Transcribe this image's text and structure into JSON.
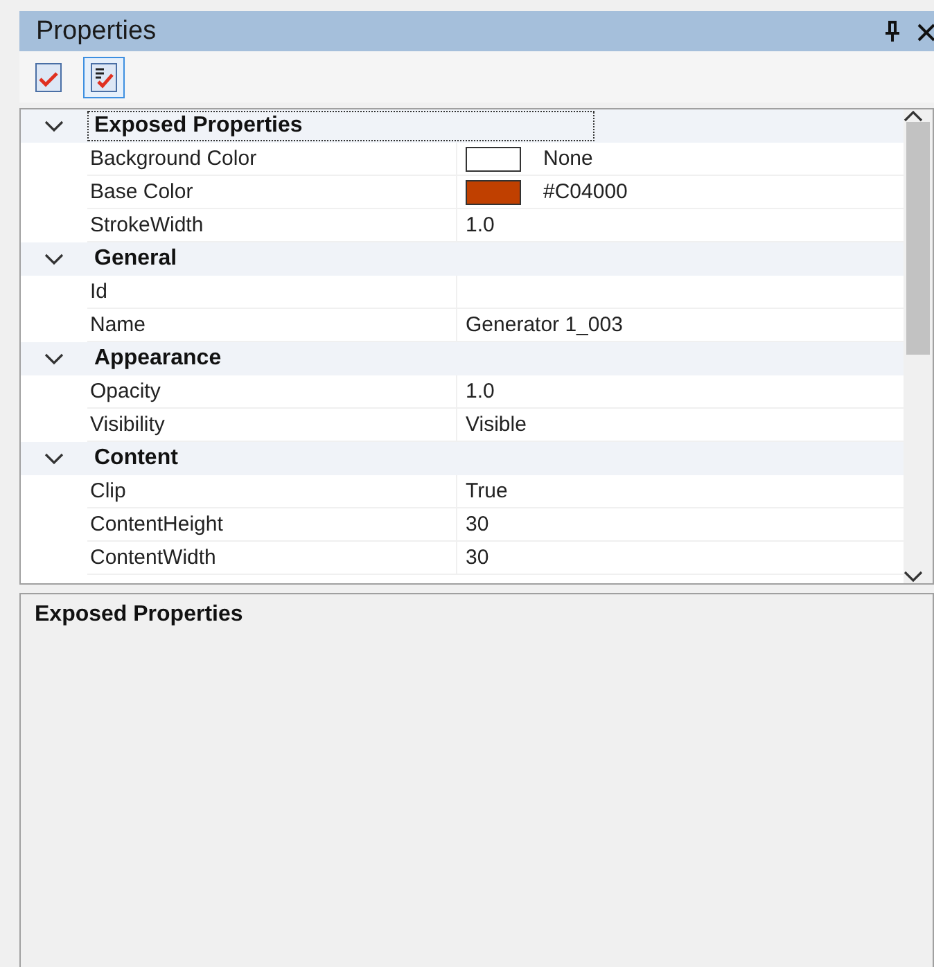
{
  "window": {
    "title": "Properties"
  },
  "toolbar": [
    {
      "kind": "categorized",
      "selected": false
    },
    {
      "kind": "alphabetical",
      "selected": true
    }
  ],
  "groups": [
    {
      "name": "Exposed Properties",
      "expanded": true,
      "focused": true,
      "properties": [
        {
          "name": "Background Color",
          "kind": "color",
          "color": "#ffffff",
          "value": "None"
        },
        {
          "name": "Base Color",
          "kind": "color",
          "color": "#c04000",
          "value": "#C04000"
        },
        {
          "name": "StrokeWidth",
          "kind": "text",
          "value": "1.0"
        }
      ]
    },
    {
      "name": "General",
      "expanded": true,
      "focused": false,
      "properties": [
        {
          "name": "Id",
          "kind": "text"
        },
        {
          "name": "Name",
          "kind": "text",
          "value": "Generator 1_003"
        }
      ]
    },
    {
      "name": "Appearance",
      "expanded": true,
      "focused": false,
      "properties": [
        {
          "name": "Opacity",
          "kind": "text",
          "value": "1.0"
        },
        {
          "name": "Visibility",
          "kind": "text",
          "value": "Visible"
        }
      ]
    },
    {
      "name": "Content",
      "expanded": true,
      "focused": false,
      "properties": [
        {
          "name": "Clip",
          "kind": "text",
          "value": "True"
        },
        {
          "name": "ContentHeight",
          "kind": "text",
          "value": "30"
        },
        {
          "name": "ContentWidth",
          "kind": "text",
          "value": "30"
        }
      ]
    }
  ],
  "description": {
    "title": "Exposed Properties"
  }
}
